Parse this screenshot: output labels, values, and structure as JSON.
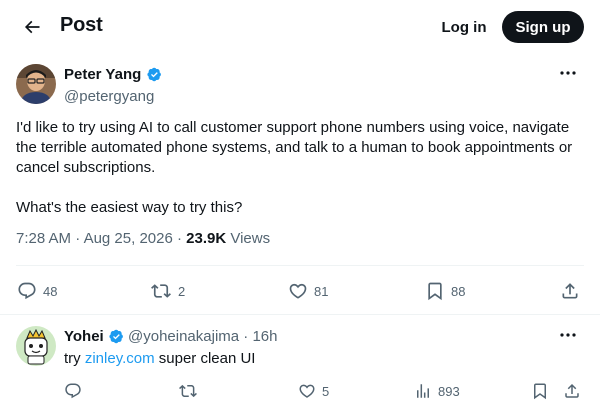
{
  "header": {
    "title": "Post",
    "login_label": "Log in",
    "signup_label": "Sign up"
  },
  "tweet": {
    "author_name": "Peter Yang",
    "author_handle": "@petergyang",
    "text": "I'd like to try using AI to call customer support phone numbers using voice, navigate the terrible automated phone systems, and talk to a human to book appointments or cancel subscriptions.\n\nWhat's the easiest way to try this?",
    "time": "7:28 AM",
    "date": "Aug 25, 2026",
    "separator": "·",
    "views_count": "23.9K",
    "views_label": "Views",
    "replies": "48",
    "reposts": "2",
    "likes": "81",
    "bookmarks": "88"
  },
  "reply": {
    "author_name": "Yohei",
    "author_handle": "@yoheinakajima",
    "separator": "·",
    "time_ago": "16h",
    "text_before": "try ",
    "link_text": "zinley.com",
    "text_after": " super clean UI",
    "likes": "5",
    "views": "893"
  },
  "colors": {
    "text": "#0f1419",
    "secondary": "#536471",
    "accent": "#1d9bf0",
    "divider": "#eff3f4"
  },
  "icons": [
    "back-arrow-icon",
    "verified-badge-icon",
    "more-icon",
    "reply-icon",
    "repost-icon",
    "like-icon",
    "bookmark-icon",
    "share-icon",
    "views-icon"
  ]
}
